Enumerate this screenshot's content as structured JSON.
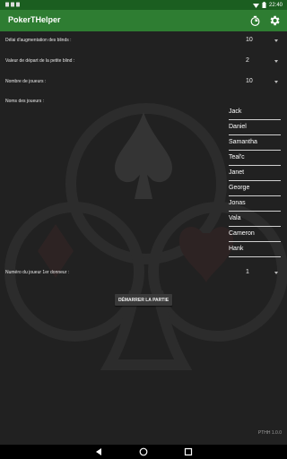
{
  "status_bar": {
    "time": "22:40"
  },
  "app_bar": {
    "title": "PokerTHelper",
    "timer_icon": "timer-icon",
    "settings_icon": "gear-icon"
  },
  "settings": {
    "blind_delay": {
      "label": "Délai d'augmentation des blinds :",
      "value": "10"
    },
    "small_blind": {
      "label": "Valeur de départ de la petite blind :",
      "value": "2"
    },
    "num_players": {
      "label": "Nombre de joueurs :",
      "value": "10"
    },
    "player_names_label": "Noms des joueurs :",
    "first_dealer": {
      "label": "Numéro du joueur 1er donneur :",
      "value": "1"
    }
  },
  "players": [
    "Jack",
    "Daniel",
    "Samantha",
    "Teal'c",
    "Janet",
    "George",
    "Jonas",
    "Vala",
    "Cameron",
    "Hank"
  ],
  "start_button": "DÉMARRER LA PARTIE",
  "version": "PTHH 1.0.0",
  "colors": {
    "app_bar": "#2e7d32",
    "status_bar": "#1b5e20",
    "background": "#212121"
  }
}
